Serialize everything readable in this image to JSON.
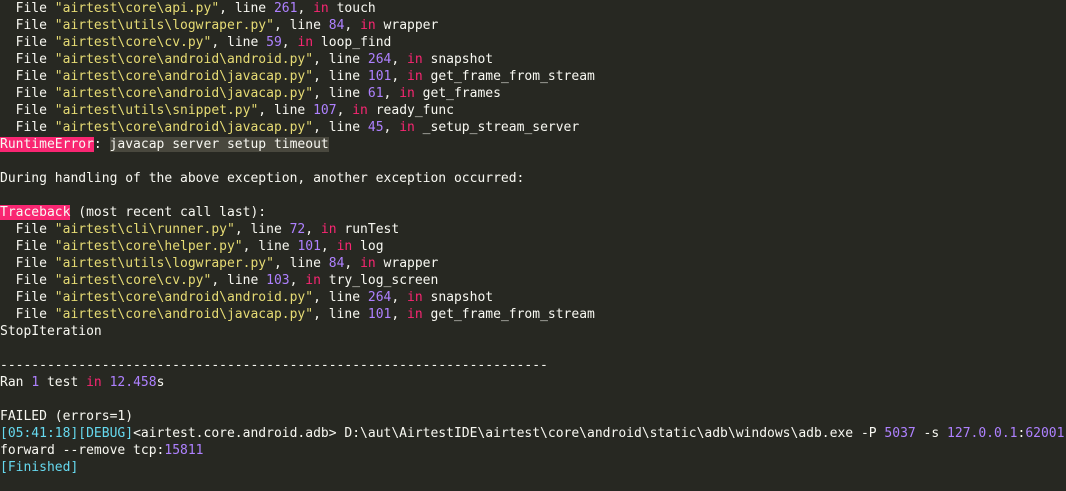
{
  "console": {
    "lines": [
      [
        {
          "t": "  File ",
          "c": "default"
        },
        {
          "t": "\"airtest\\core\\api.py\"",
          "c": "str"
        },
        {
          "t": ", line ",
          "c": "default"
        },
        {
          "t": "261",
          "c": "num"
        },
        {
          "t": ", ",
          "c": "default"
        },
        {
          "t": "in",
          "c": "kw"
        },
        {
          "t": " touch",
          "c": "default"
        }
      ],
      [
        {
          "t": "  File ",
          "c": "default"
        },
        {
          "t": "\"airtest\\utils\\logwraper.py\"",
          "c": "str"
        },
        {
          "t": ", line ",
          "c": "default"
        },
        {
          "t": "84",
          "c": "num"
        },
        {
          "t": ", ",
          "c": "default"
        },
        {
          "t": "in",
          "c": "kw"
        },
        {
          "t": " wrapper",
          "c": "default"
        }
      ],
      [
        {
          "t": "  File ",
          "c": "default"
        },
        {
          "t": "\"airtest\\core\\cv.py\"",
          "c": "str"
        },
        {
          "t": ", line ",
          "c": "default"
        },
        {
          "t": "59",
          "c": "num"
        },
        {
          "t": ", ",
          "c": "default"
        },
        {
          "t": "in",
          "c": "kw"
        },
        {
          "t": " loop_find",
          "c": "default"
        }
      ],
      [
        {
          "t": "  File ",
          "c": "default"
        },
        {
          "t": "\"airtest\\core\\android\\android.py\"",
          "c": "str"
        },
        {
          "t": ", line ",
          "c": "default"
        },
        {
          "t": "264",
          "c": "num"
        },
        {
          "t": ", ",
          "c": "default"
        },
        {
          "t": "in",
          "c": "kw"
        },
        {
          "t": " snapshot",
          "c": "default"
        }
      ],
      [
        {
          "t": "  File ",
          "c": "default"
        },
        {
          "t": "\"airtest\\core\\android\\javacap.py\"",
          "c": "str"
        },
        {
          "t": ", line ",
          "c": "default"
        },
        {
          "t": "101",
          "c": "num"
        },
        {
          "t": ", ",
          "c": "default"
        },
        {
          "t": "in",
          "c": "kw"
        },
        {
          "t": " get_frame_from_stream",
          "c": "default"
        }
      ],
      [
        {
          "t": "  File ",
          "c": "default"
        },
        {
          "t": "\"airtest\\core\\android\\javacap.py\"",
          "c": "str"
        },
        {
          "t": ", line ",
          "c": "default"
        },
        {
          "t": "61",
          "c": "num"
        },
        {
          "t": ", ",
          "c": "default"
        },
        {
          "t": "in",
          "c": "kw"
        },
        {
          "t": " get_frames",
          "c": "default"
        }
      ],
      [
        {
          "t": "  File ",
          "c": "default"
        },
        {
          "t": "\"airtest\\utils\\snippet.py\"",
          "c": "str"
        },
        {
          "t": ", line ",
          "c": "default"
        },
        {
          "t": "107",
          "c": "num"
        },
        {
          "t": ", ",
          "c": "default"
        },
        {
          "t": "in",
          "c": "kw"
        },
        {
          "t": " ready_func",
          "c": "default"
        }
      ],
      [
        {
          "t": "  File ",
          "c": "default"
        },
        {
          "t": "\"airtest\\core\\android\\javacap.py\"",
          "c": "str"
        },
        {
          "t": ", line ",
          "c": "default"
        },
        {
          "t": "45",
          "c": "num"
        },
        {
          "t": ", ",
          "c": "default"
        },
        {
          "t": "in",
          "c": "kw"
        },
        {
          "t": " _setup_stream_server",
          "c": "default"
        }
      ],
      [
        {
          "t": "RuntimeError",
          "c": "err"
        },
        {
          "t": ": ",
          "c": "default"
        },
        {
          "t": "javacap server setup timeout",
          "c": "hl"
        }
      ],
      [],
      [
        {
          "t": "During handling of the above exception, another exception occurred:",
          "c": "default"
        }
      ],
      [],
      [
        {
          "t": "Traceback",
          "c": "err"
        },
        {
          "t": " (most recent call last):",
          "c": "default"
        }
      ],
      [
        {
          "t": "  File ",
          "c": "default"
        },
        {
          "t": "\"airtest\\cli\\runner.py\"",
          "c": "str"
        },
        {
          "t": ", line ",
          "c": "default"
        },
        {
          "t": "72",
          "c": "num"
        },
        {
          "t": ", ",
          "c": "default"
        },
        {
          "t": "in",
          "c": "kw"
        },
        {
          "t": " runTest",
          "c": "default"
        }
      ],
      [
        {
          "t": "  File ",
          "c": "default"
        },
        {
          "t": "\"airtest\\core\\helper.py\"",
          "c": "str"
        },
        {
          "t": ", line ",
          "c": "default"
        },
        {
          "t": "101",
          "c": "num"
        },
        {
          "t": ", ",
          "c": "default"
        },
        {
          "t": "in",
          "c": "kw"
        },
        {
          "t": " log",
          "c": "default"
        }
      ],
      [
        {
          "t": "  File ",
          "c": "default"
        },
        {
          "t": "\"airtest\\utils\\logwraper.py\"",
          "c": "str"
        },
        {
          "t": ", line ",
          "c": "default"
        },
        {
          "t": "84",
          "c": "num"
        },
        {
          "t": ", ",
          "c": "default"
        },
        {
          "t": "in",
          "c": "kw"
        },
        {
          "t": " wrapper",
          "c": "default"
        }
      ],
      [
        {
          "t": "  File ",
          "c": "default"
        },
        {
          "t": "\"airtest\\core\\cv.py\"",
          "c": "str"
        },
        {
          "t": ", line ",
          "c": "default"
        },
        {
          "t": "103",
          "c": "num"
        },
        {
          "t": ", ",
          "c": "default"
        },
        {
          "t": "in",
          "c": "kw"
        },
        {
          "t": " try_log_screen",
          "c": "default"
        }
      ],
      [
        {
          "t": "  File ",
          "c": "default"
        },
        {
          "t": "\"airtest\\core\\android\\android.py\"",
          "c": "str"
        },
        {
          "t": ", line ",
          "c": "default"
        },
        {
          "t": "264",
          "c": "num"
        },
        {
          "t": ", ",
          "c": "default"
        },
        {
          "t": "in",
          "c": "kw"
        },
        {
          "t": " snapshot",
          "c": "default"
        }
      ],
      [
        {
          "t": "  File ",
          "c": "default"
        },
        {
          "t": "\"airtest\\core\\android\\javacap.py\"",
          "c": "str"
        },
        {
          "t": ", line ",
          "c": "default"
        },
        {
          "t": "101",
          "c": "num"
        },
        {
          "t": ", ",
          "c": "default"
        },
        {
          "t": "in",
          "c": "kw"
        },
        {
          "t": " get_frame_from_stream",
          "c": "default"
        }
      ],
      [
        {
          "t": "StopIteration",
          "c": "default"
        }
      ],
      [],
      [
        {
          "t": "----------------------------------------------------------------------",
          "c": "default"
        }
      ],
      [
        {
          "t": "Ran ",
          "c": "default"
        },
        {
          "t": "1",
          "c": "num"
        },
        {
          "t": " test ",
          "c": "default"
        },
        {
          "t": "in",
          "c": "kw"
        },
        {
          "t": " ",
          "c": "default"
        },
        {
          "t": "12.458",
          "c": "num"
        },
        {
          "t": "s",
          "c": "default"
        }
      ],
      [],
      [
        {
          "t": "FAILED (errors=1)",
          "c": "default"
        }
      ],
      [
        {
          "t": "[05:41:18][DEBUG]",
          "c": "cyan"
        },
        {
          "t": "<airtest.core.android.adb> D:\\aut\\AirtestIDE\\airtest\\core\\android\\static\\adb\\windows\\adb.exe -P ",
          "c": "default"
        },
        {
          "t": "5037",
          "c": "num"
        },
        {
          "t": " -s ",
          "c": "default"
        },
        {
          "t": "127.0.0.1",
          "c": "num"
        },
        {
          "t": ":",
          "c": "default"
        },
        {
          "t": "62001",
          "c": "num"
        }
      ],
      [
        {
          "t": "forward --remove tcp:",
          "c": "default"
        },
        {
          "t": "15811",
          "c": "num"
        }
      ],
      [
        {
          "t": "[Finished]",
          "c": "cyan"
        }
      ]
    ]
  }
}
